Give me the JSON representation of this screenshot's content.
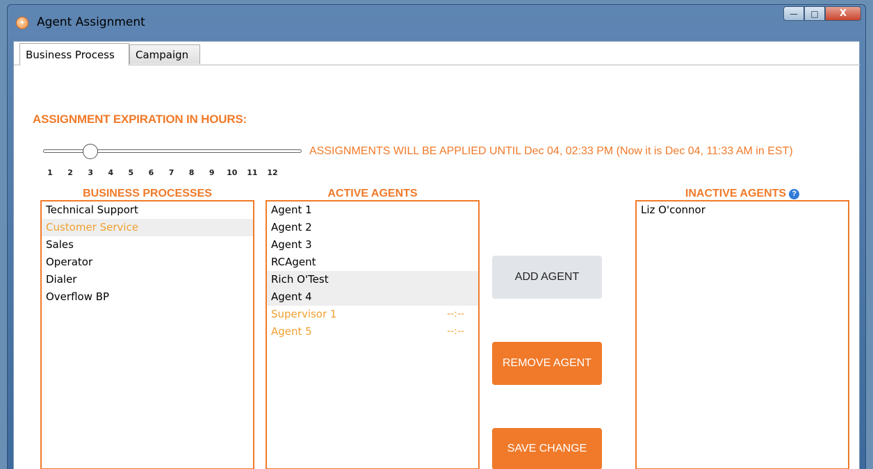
{
  "window": {
    "title": "Agent Assignment",
    "controls": {
      "minimize": "—",
      "maximize": "□",
      "close": "X"
    }
  },
  "tabs": [
    {
      "label": "Business Process",
      "active": true
    },
    {
      "label": "Campaign",
      "active": false
    }
  ],
  "expiration": {
    "label": "ASSIGNMENT EXPIRATION IN HOURS:",
    "value": 3,
    "min": 1,
    "max": 12,
    "ticks": [
      "1",
      "2",
      "3",
      "4",
      "5",
      "6",
      "7",
      "8",
      "9",
      "10",
      "11",
      "12"
    ],
    "apply_text": "ASSIGNMENTS WILL BE APPLIED UNTIL Dec 04, 02:33 PM (Now it is Dec 04, 11:33 AM in EST)"
  },
  "business_processes": {
    "header": "BUSINESS PROCESSES",
    "items": [
      "Technical Support",
      "Customer Service",
      "Sales",
      "Operator",
      "Dialer",
      "Overflow BP"
    ]
  },
  "active_agents": {
    "header": "ACTIVE AGENTS",
    "items": [
      {
        "name": "Agent 1",
        "time": ""
      },
      {
        "name": "Agent 2",
        "time": ""
      },
      {
        "name": "Agent 3",
        "time": ""
      },
      {
        "name": "RCAgent",
        "time": ""
      },
      {
        "name": "Rich O'Test",
        "time": ""
      },
      {
        "name": "Agent 4",
        "time": ""
      },
      {
        "name": "Supervisor 1",
        "time": "--:--"
      },
      {
        "name": "Agent 5",
        "time": "--:--"
      }
    ]
  },
  "inactive_agents": {
    "header": "INACTIVE AGENTS",
    "help": "?",
    "items": [
      "Liz O'connor"
    ]
  },
  "buttons": {
    "add": "ADD AGENT",
    "remove": "REMOVE AGENT",
    "save": "SAVE CHANGE"
  },
  "colors": {
    "accent": "#f07a2a",
    "highlight": "#f0a030",
    "help": "#2e7bd6"
  }
}
